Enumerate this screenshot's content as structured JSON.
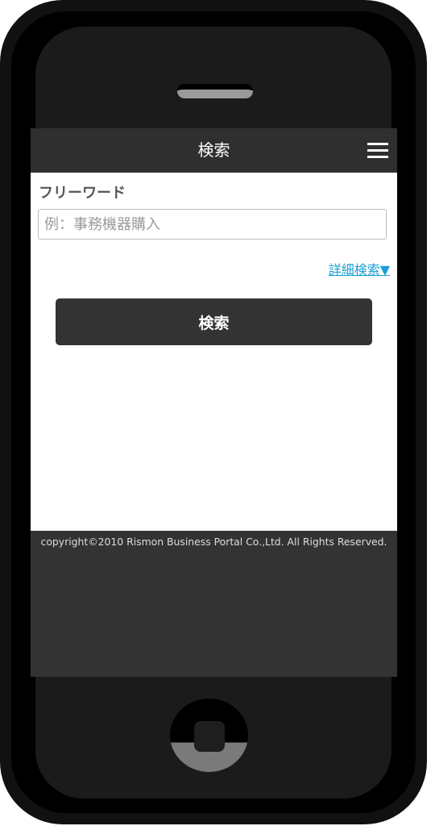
{
  "header": {
    "title": "検索",
    "menu_icon": "hamburger-menu-icon"
  },
  "form": {
    "free_word_label": "フリーワード",
    "free_word_value": "",
    "free_word_placeholder": "例：事務機器購入",
    "advanced_search_label": "詳細検索▼",
    "search_button_label": "検索"
  },
  "footer": {
    "copyright": "copyright©2010 Rismon Business Portal Co.,Ltd. All Rights Reserved."
  },
  "colors": {
    "header_bg": "#2f2f2f",
    "button_bg": "#333333",
    "link": "#1a9fd6",
    "footer_bg": "#333333"
  }
}
